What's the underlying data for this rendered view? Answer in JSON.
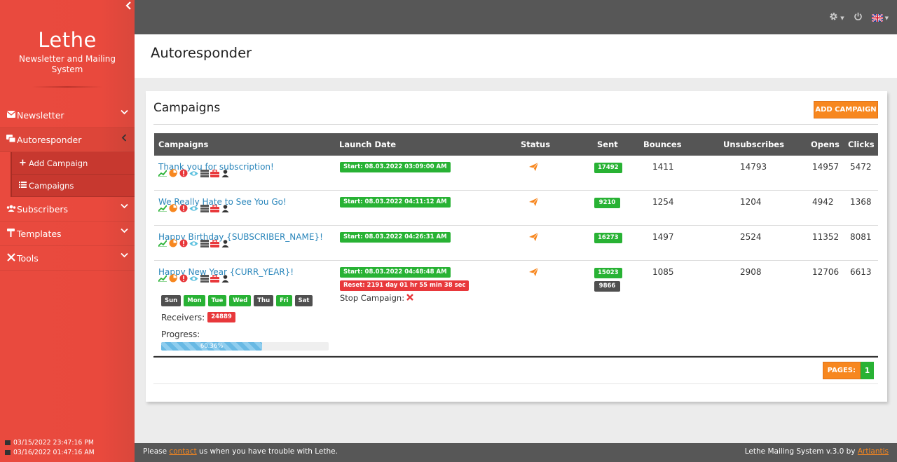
{
  "sidebar": {
    "brand_title": "Lethe",
    "brand_subtitle_1": "Newsletter and Mailing",
    "brand_subtitle_2": "System",
    "menu": {
      "newsletter": "Newsletter",
      "autoresponder": "Autoresponder",
      "add_campaign": "Add Campaign",
      "campaigns": "Campaigns",
      "subscribers": "Subscribers",
      "templates": "Templates",
      "tools": "Tools"
    },
    "clock_1": "03/15/2022 23:47:16 PM",
    "clock_2": "03/16/2022 01:47:16 AM"
  },
  "page": {
    "title": "Autoresponder"
  },
  "panel": {
    "title": "Campaigns",
    "add_button": "ADD CAMPAIGN",
    "columns": {
      "campaigns": "Campaigns",
      "launch_date": "Launch Date",
      "status": "Status",
      "sent": "Sent",
      "bounces": "Bounces",
      "unsubscribes": "Unsubscribes",
      "opens": "Opens",
      "clicks": "Clicks"
    },
    "rows": [
      {
        "name": "Thank you for subscription!",
        "launch": "Start: 08.03.2022 03:09:00 AM",
        "sent": "17492",
        "bounces": "1411",
        "unsubscribes": "14793",
        "opens": "14957",
        "clicks": "5472"
      },
      {
        "name": "We Really Hate to See You Go!",
        "launch": "Start: 08.03.2022 04:11:12 AM",
        "sent": "9210",
        "bounces": "1254",
        "unsubscribes": "1204",
        "opens": "4942",
        "clicks": "1368"
      },
      {
        "name": "Happy Birthday {SUBSCRIBER_NAME}!",
        "launch": "Start: 08.03.2022 04:26:31 AM",
        "sent": "16273",
        "bounces": "1497",
        "unsubscribes": "2524",
        "opens": "11352",
        "clicks": "8081"
      },
      {
        "name": "Happy New Year {CURR_YEAR}!",
        "launch": "Start: 08.03.2022 04:48:48 AM",
        "reset": "Reset: 2191 day 01 hr 55 min 38 sec",
        "stop_label": "Stop Campaign:",
        "sent": "15023",
        "sent_2": "9866",
        "bounces": "1085",
        "unsubscribes": "2908",
        "opens": "12706",
        "clicks": "6613",
        "days": [
          "Sun",
          "Mon",
          "Tue",
          "Wed",
          "Thu",
          "Fri",
          "Sat"
        ],
        "receivers_label": "Receivers:",
        "receivers": "24889",
        "progress_label": "Progress:",
        "progress_text": "60.36%",
        "progress_value": 60.36
      }
    ],
    "pages_label": "PAGES:",
    "current_page": "1"
  },
  "footer": {
    "left_pre": "Please ",
    "left_link": "contact",
    "left_post": " us when you have trouble with Lethe.",
    "right_pre": "Lethe Mailing System v.3.0 by ",
    "right_link": "Artlantis"
  },
  "colors": {
    "sidebar": "#e94a3e",
    "accent_orange": "#f7871f",
    "green": "#28b234",
    "red": "#e8383b",
    "topbar": "#575757",
    "link": "#2a86bb"
  },
  "icons": [
    "envelope-icon",
    "cog-icon",
    "power-icon",
    "uk-flag-icon",
    "chart-icon",
    "pie-icon",
    "alert-icon",
    "eye-icon",
    "server-icon",
    "toolbox-icon",
    "user-icon",
    "paper-plane-icon",
    "times-icon"
  ]
}
